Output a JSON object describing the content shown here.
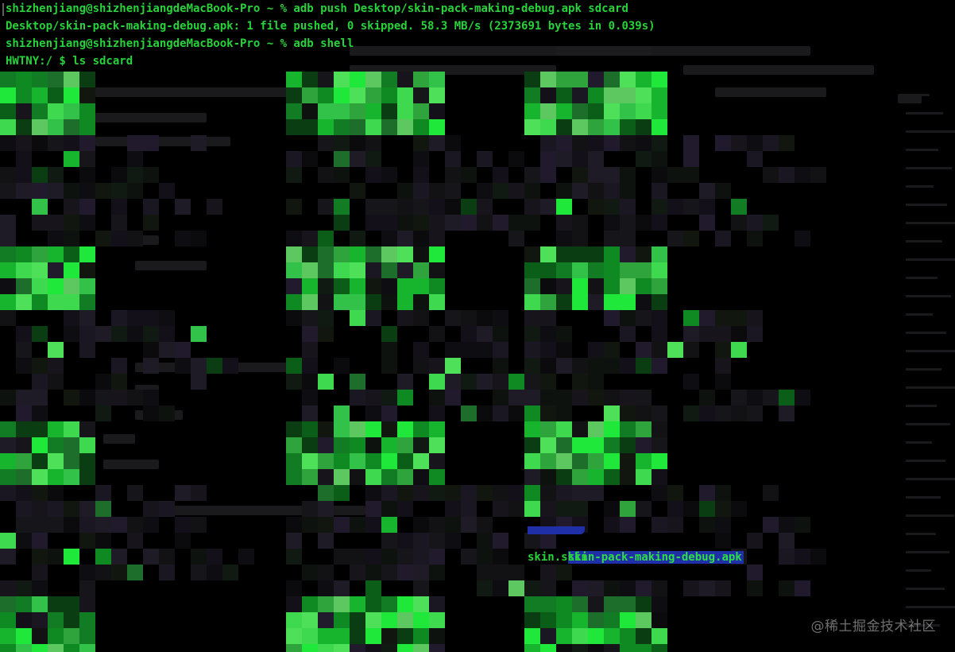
{
  "terminal": {
    "lines": [
      "shizhenjiang@shizhenjiangdeMacBook-Pro ~ % adb push Desktop/skin-pack-making-debug.apk sdcard",
      "Desktop/skin-pack-making-debug.apk: 1 file pushed, 0 skipped. 58.3 MB/s (2373691 bytes in 0.039s)",
      "shizhenjiang@shizhenjiangdeMacBook-Pro ~ % adb shell",
      "HWTNY:/ $ ls sdcard"
    ],
    "visible_listing": {
      "partial_entry": "",
      "selected_entry": "skin-pack-making-debug.apk",
      "next_entry": "skin.skin"
    },
    "bottom_partial_left": "",
    "bottom_partial_mid": ""
  },
  "watermark": {
    "text": "@稀土掘金技术社区"
  },
  "colors": {
    "background": "#000000",
    "text": "#28d23a",
    "selection": "#1f2fa8"
  }
}
